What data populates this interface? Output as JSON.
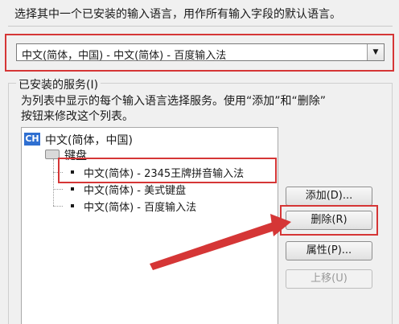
{
  "header": {
    "instruction": "选择其中一个已安装的输入语言，用作所有输入字段的默认语言。"
  },
  "default_language": {
    "selected": "中文(简体，中国) - 中文(简体) - 百度输入法"
  },
  "services": {
    "group_label": "已安装的服务(I)",
    "description_line1": "为列表中显示的每个输入语言选择服务。使用“添加”和“删除”",
    "description_line2": "按钮来修改这个列表。",
    "language_badge": "CH",
    "language_name": "中文(简体，中国)",
    "category": "键盘",
    "items": [
      "中文(简体) - 2345王牌拼音输入法",
      "中文(简体) - 美式键盘",
      "中文(简体) - 百度输入法"
    ]
  },
  "buttons": {
    "add": "添加(D)...",
    "remove": "删除(R)",
    "properties": "属性(P)...",
    "move_up": "上移(U)"
  },
  "colors": {
    "highlight": "#d53636",
    "badge": "#2f6fd1"
  }
}
